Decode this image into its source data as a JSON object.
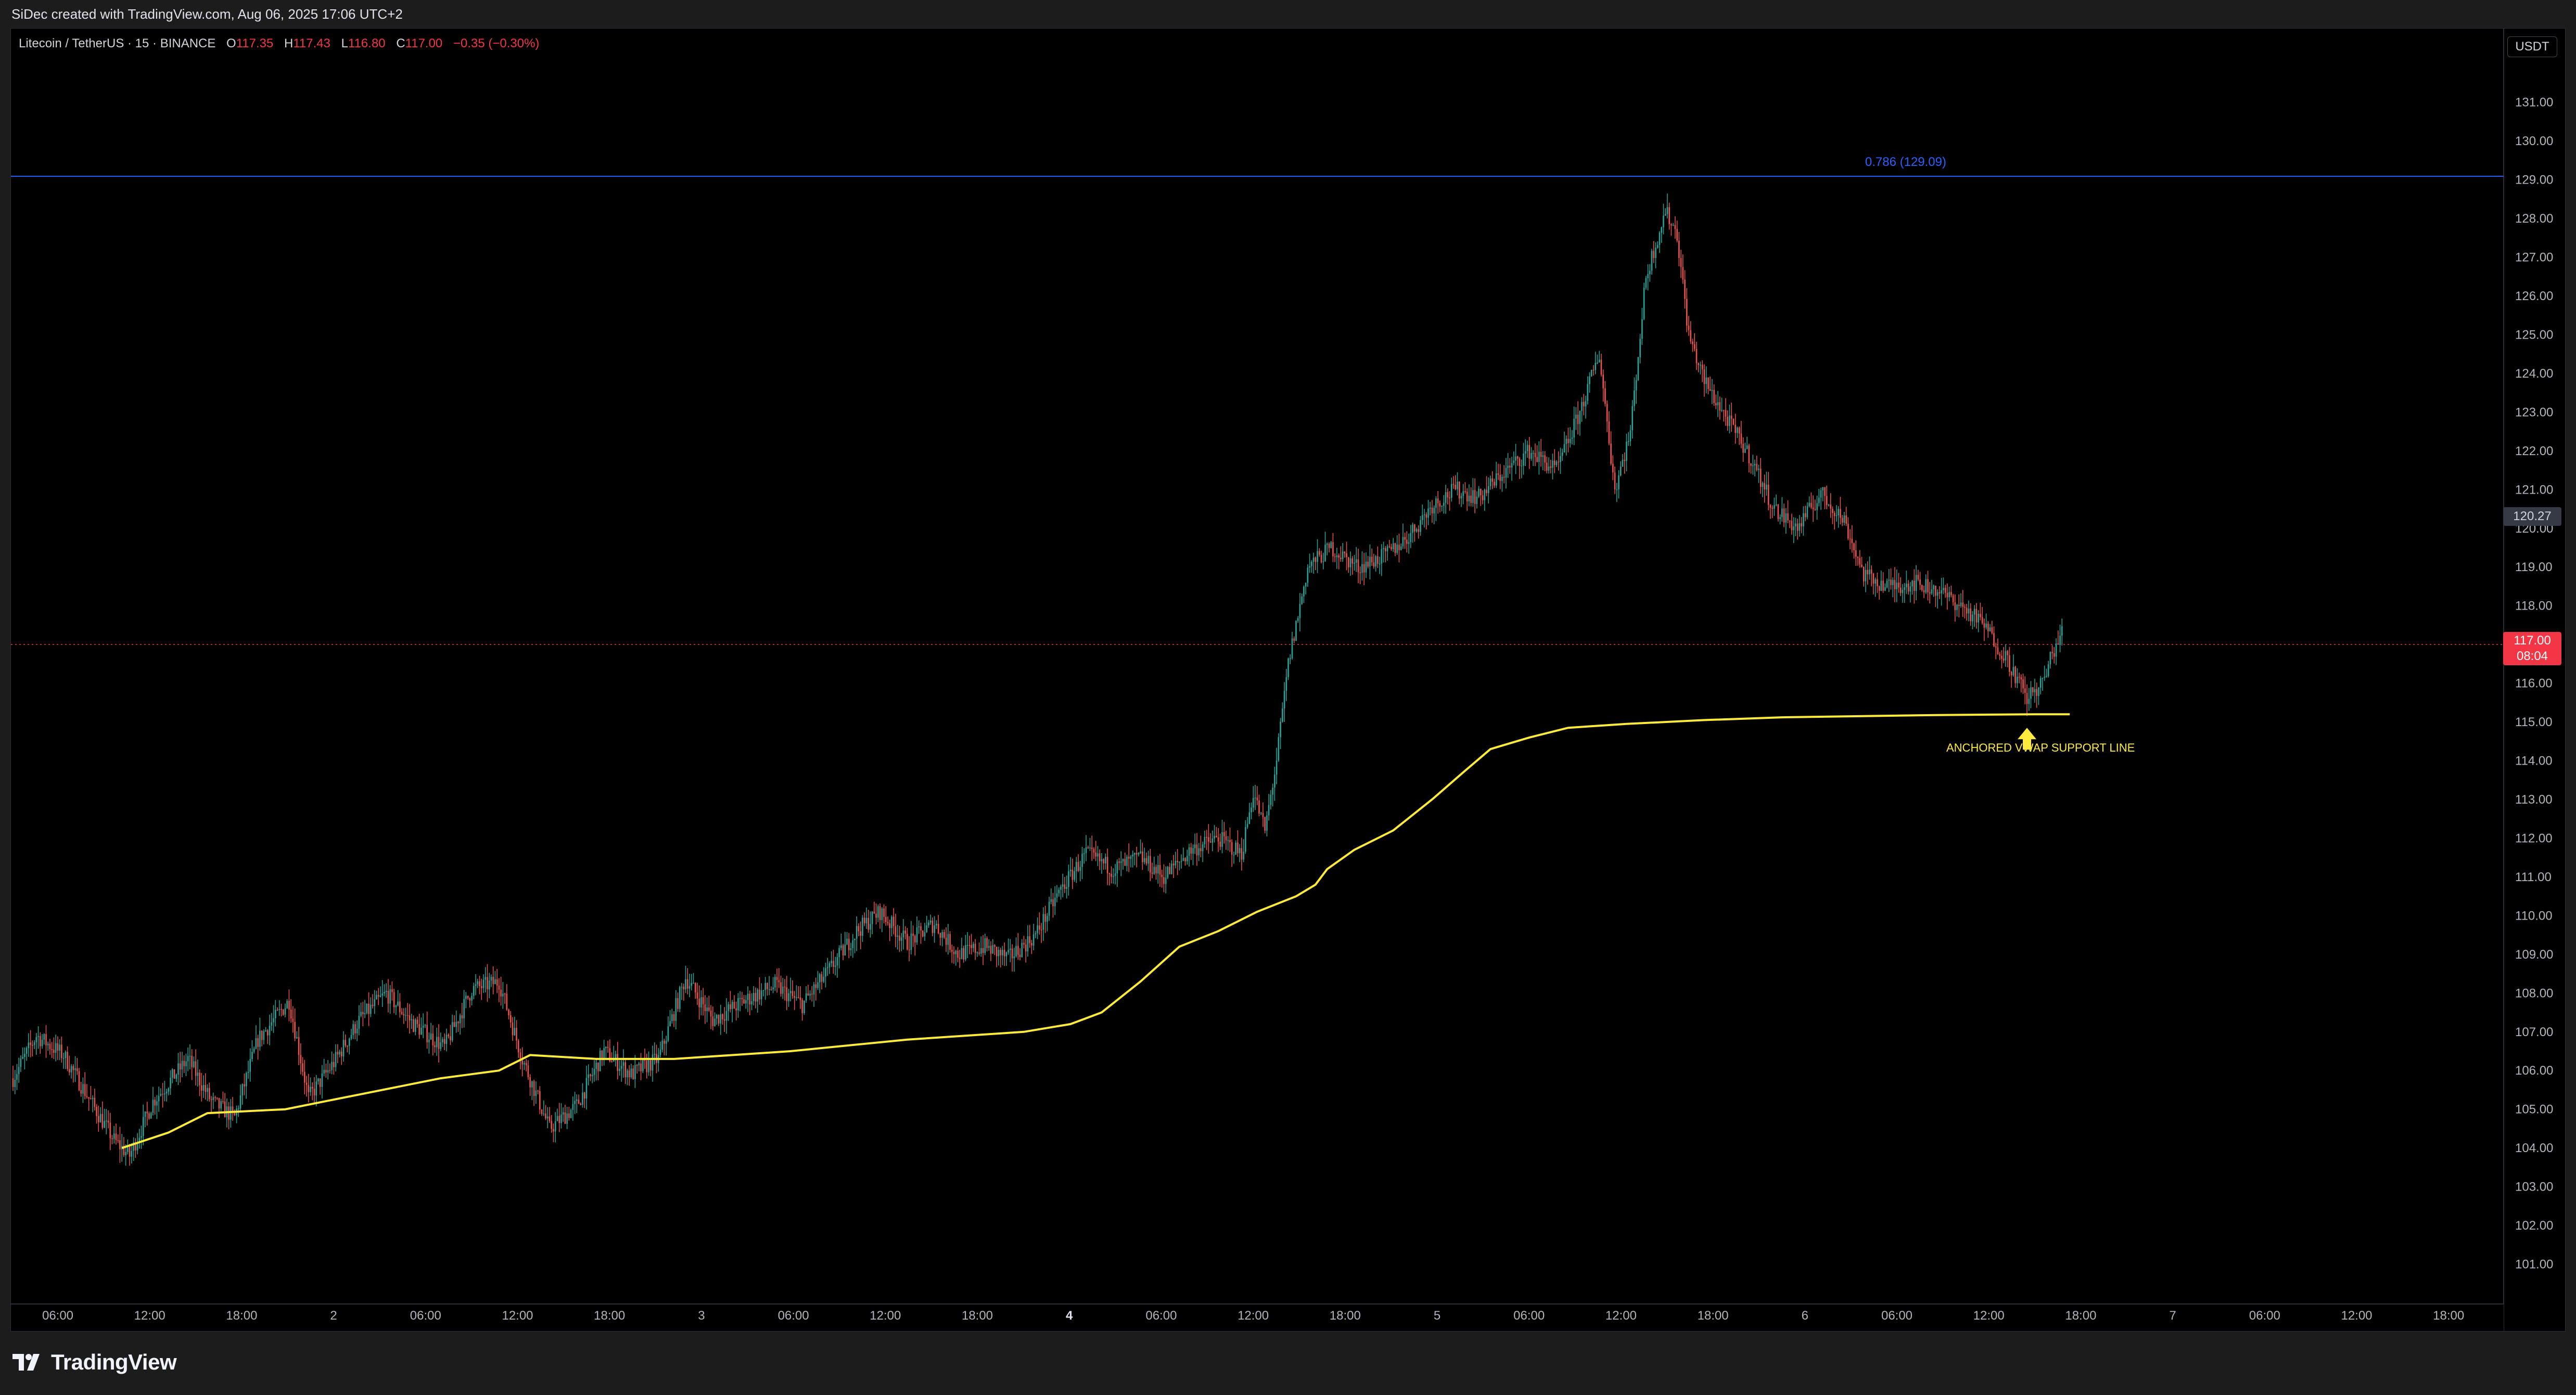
{
  "header": {
    "created_by": "SiDec created with TradingView.com, Aug 06, 2025 17:06 UTC+2"
  },
  "legend": {
    "symbol": "Litecoin / TetherUS · 15 · BINANCE",
    "o_label": "O",
    "o_value": "117.35",
    "h_label": "H",
    "h_value": "117.43",
    "l_label": "L",
    "l_value": "116.80",
    "c_label": "C",
    "c_value": "117.00",
    "change": "−0.35 (−0.30%)"
  },
  "price_scale": {
    "unit": "USDT",
    "crosshair_price": "120.27",
    "last_price": "117.00",
    "countdown": "08:04"
  },
  "fib": {
    "label": "0.786 (129.09)",
    "price": 129.09
  },
  "annotation": {
    "text": "ANCHORED VWAP SUPPORT LINE"
  },
  "footer": {
    "brand": "TradingView"
  },
  "colors": {
    "up": "#26a69a",
    "down": "#ef5350",
    "vwap": "#ffeb3b",
    "fib": "#2962ff",
    "last_price": "#f23645"
  },
  "chart_data": {
    "type": "candlestick",
    "symbol": "LTCUSDT",
    "interval": "15",
    "ylim": [
      100,
      132.5
    ],
    "y_ticks": [
      "101.00",
      "102.00",
      "103.00",
      "104.00",
      "105.00",
      "106.00",
      "107.00",
      "108.00",
      "109.00",
      "110.00",
      "111.00",
      "112.00",
      "113.00",
      "114.00",
      "115.00",
      "116.00",
      "117.00",
      "118.00",
      "119.00",
      "120.00",
      "121.00",
      "122.00",
      "123.00",
      "124.00",
      "125.00",
      "126.00",
      "127.00",
      "128.00",
      "129.00",
      "130.00",
      "131.00"
    ],
    "x_ticks": [
      {
        "label": "06:00"
      },
      {
        "label": "12:00"
      },
      {
        "label": "18:00"
      },
      {
        "label": "2",
        "bold": false
      },
      {
        "label": "06:00"
      },
      {
        "label": "12:00"
      },
      {
        "label": "18:00"
      },
      {
        "label": "3"
      },
      {
        "label": "06:00"
      },
      {
        "label": "12:00"
      },
      {
        "label": "18:00"
      },
      {
        "label": "4",
        "bold": true
      },
      {
        "label": "06:00"
      },
      {
        "label": "12:00"
      },
      {
        "label": "18:00"
      },
      {
        "label": "5"
      },
      {
        "label": "06:00"
      },
      {
        "label": "12:00"
      },
      {
        "label": "18:00"
      },
      {
        "label": "6"
      },
      {
        "label": "06:00"
      },
      {
        "label": "12:00"
      },
      {
        "label": "18:00"
      },
      {
        "label": "7"
      },
      {
        "label": "06:00"
      },
      {
        "label": "12:00"
      },
      {
        "label": "18:00"
      }
    ],
    "price_path": [
      [
        0,
        105.8
      ],
      [
        12,
        106.9
      ],
      [
        26,
        106.4
      ],
      [
        40,
        105.2
      ],
      [
        52,
        104.2
      ],
      [
        60,
        103.8
      ],
      [
        72,
        105.2
      ],
      [
        90,
        106.3
      ],
      [
        102,
        105.2
      ],
      [
        114,
        104.8
      ],
      [
        126,
        106.8
      ],
      [
        142,
        107.8
      ],
      [
        152,
        105.3
      ],
      [
        165,
        106.2
      ],
      [
        178,
        107.3
      ],
      [
        192,
        108.0
      ],
      [
        206,
        107.2
      ],
      [
        222,
        106.6
      ],
      [
        236,
        108.1
      ],
      [
        250,
        108.3
      ],
      [
        262,
        106.3
      ],
      [
        276,
        104.5
      ],
      [
        290,
        105.1
      ],
      [
        304,
        106.5
      ],
      [
        318,
        105.9
      ],
      [
        332,
        106.3
      ],
      [
        346,
        108.4
      ],
      [
        360,
        107.3
      ],
      [
        376,
        107.8
      ],
      [
        392,
        108.2
      ],
      [
        406,
        107.7
      ],
      [
        420,
        108.6
      ],
      [
        434,
        109.6
      ],
      [
        446,
        110.1
      ],
      [
        460,
        109.3
      ],
      [
        474,
        109.8
      ],
      [
        486,
        109.0
      ],
      [
        500,
        109.2
      ],
      [
        512,
        108.9
      ],
      [
        526,
        109.5
      ],
      [
        538,
        110.6
      ],
      [
        552,
        111.6
      ],
      [
        566,
        111.2
      ],
      [
        580,
        111.5
      ],
      [
        592,
        111.0
      ],
      [
        606,
        111.7
      ],
      [
        620,
        112.0
      ],
      [
        632,
        111.6
      ],
      [
        638,
        113.2
      ],
      [
        644,
        112.2
      ],
      [
        650,
        114.0
      ],
      [
        656,
        116.5
      ],
      [
        666,
        119.0
      ],
      [
        678,
        119.5
      ],
      [
        692,
        119.0
      ],
      [
        706,
        119.3
      ],
      [
        718,
        119.8
      ],
      [
        730,
        120.6
      ],
      [
        742,
        121.0
      ],
      [
        754,
        120.8
      ],
      [
        766,
        121.4
      ],
      [
        780,
        122.0
      ],
      [
        794,
        121.5
      ],
      [
        806,
        123.0
      ],
      [
        816,
        124.5
      ],
      [
        824,
        121.0
      ],
      [
        832,
        122.5
      ],
      [
        840,
        126.5
      ],
      [
        850,
        128.2
      ],
      [
        856,
        127.6
      ],
      [
        862,
        125.0
      ],
      [
        870,
        123.8
      ],
      [
        882,
        122.8
      ],
      [
        894,
        121.8
      ],
      [
        906,
        120.5
      ],
      [
        918,
        120.0
      ],
      [
        930,
        120.9
      ],
      [
        942,
        120.2
      ],
      [
        952,
        118.8
      ],
      [
        964,
        118.5
      ],
      [
        978,
        118.6
      ],
      [
        990,
        118.4
      ],
      [
        1002,
        118.0
      ],
      [
        1014,
        117.5
      ],
      [
        1026,
        116.6
      ],
      [
        1036,
        115.6
      ],
      [
        1044,
        116.0
      ],
      [
        1050,
        116.9
      ],
      [
        1054,
        117.3
      ]
    ],
    "vwap_path": [
      [
        56,
        104.0
      ],
      [
        80,
        104.4
      ],
      [
        100,
        104.9
      ],
      [
        140,
        105.0
      ],
      [
        180,
        105.4
      ],
      [
        220,
        105.8
      ],
      [
        250,
        106.0
      ],
      [
        266,
        106.4
      ],
      [
        300,
        106.3
      ],
      [
        340,
        106.3
      ],
      [
        400,
        106.5
      ],
      [
        460,
        106.8
      ],
      [
        520,
        107.0
      ],
      [
        544,
        107.2
      ],
      [
        560,
        107.5
      ],
      [
        580,
        108.3
      ],
      [
        600,
        109.2
      ],
      [
        620,
        109.6
      ],
      [
        640,
        110.1
      ],
      [
        660,
        110.5
      ],
      [
        670,
        110.8
      ],
      [
        676,
        111.2
      ],
      [
        690,
        111.7
      ],
      [
        710,
        112.2
      ],
      [
        730,
        113.0
      ],
      [
        746,
        113.7
      ],
      [
        760,
        114.3
      ],
      [
        780,
        114.6
      ],
      [
        800,
        114.85
      ],
      [
        830,
        114.95
      ],
      [
        870,
        115.05
      ],
      [
        910,
        115.12
      ],
      [
        950,
        115.15
      ],
      [
        990,
        115.18
      ],
      [
        1040,
        115.2
      ],
      [
        1058,
        115.2
      ]
    ]
  }
}
